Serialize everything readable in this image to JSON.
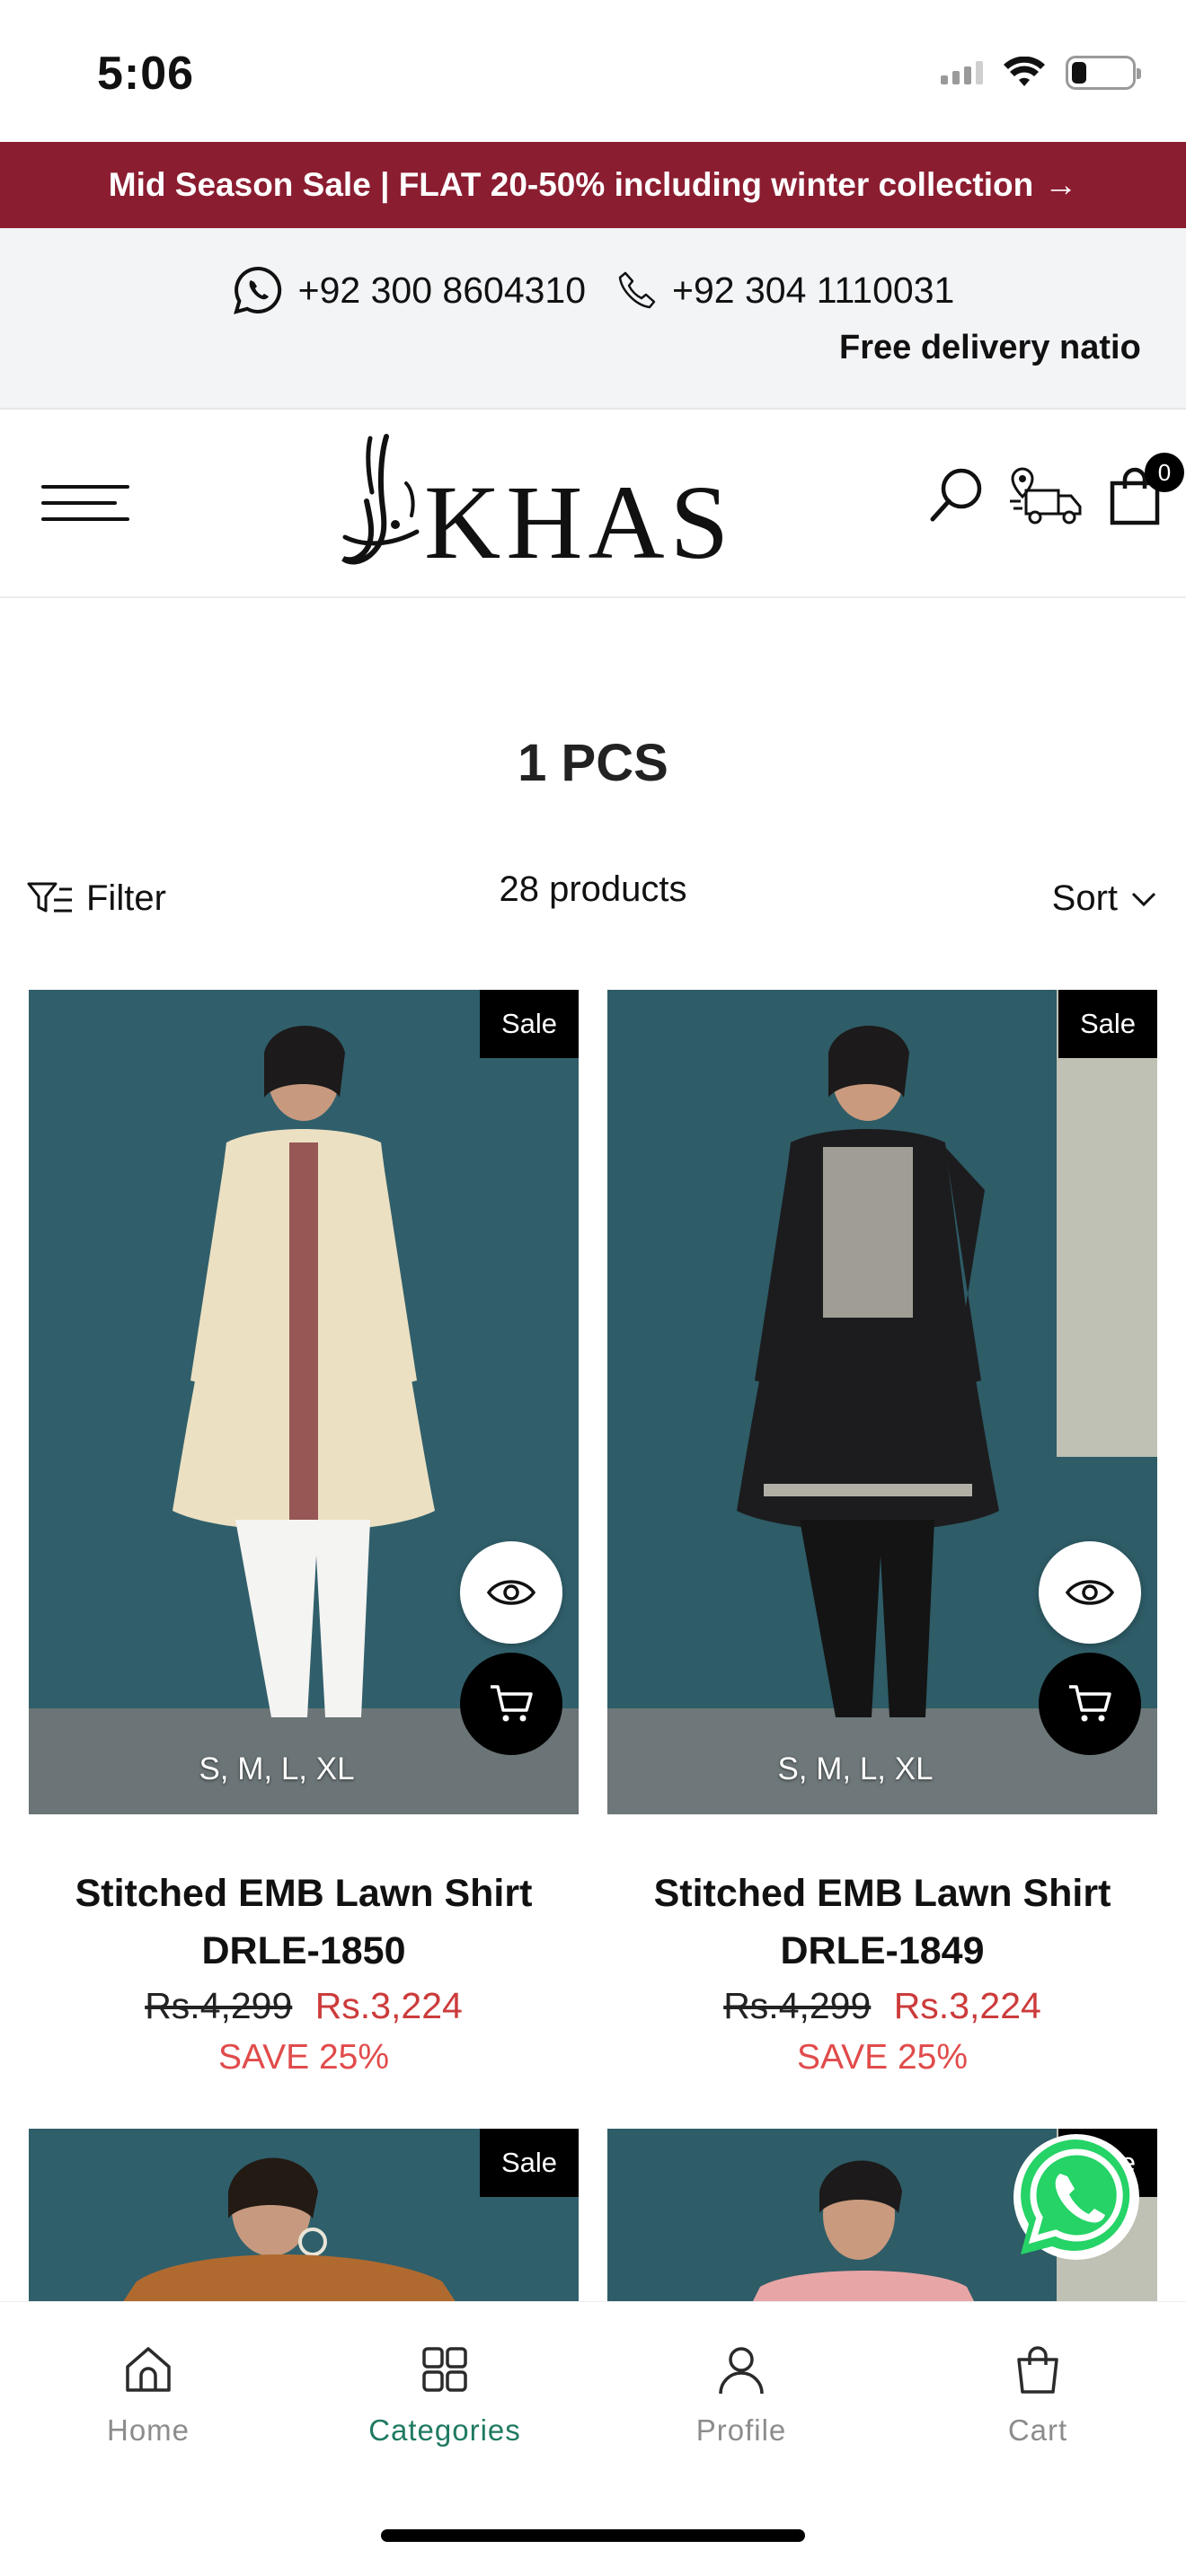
{
  "status_bar": {
    "time": "5:06",
    "battery_level": 0.25
  },
  "promo": {
    "text": "Mid Season Sale | FLAT 20-50% including winter collection",
    "arrow": "→"
  },
  "contact": {
    "whatsapp": "+92 300 8604310",
    "phone": "+92 304 1110031",
    "marquee": "Free delivery natio"
  },
  "header": {
    "logo_text": "KHAS",
    "cart_count": "0"
  },
  "collection": {
    "title": "1 PCS",
    "filter_label": "Filter",
    "count": "28 products",
    "sort_label": "Sort"
  },
  "products": [
    {
      "badge": "Sale",
      "sizes": "S, M, L, XL",
      "name": "Stitched EMB Lawn Shirt DRLE-1850",
      "old_price": "Rs.4,299",
      "new_price": "Rs.3,224",
      "save": "SAVE 25%",
      "dress_color": "#ece0c2",
      "accent_color": "#7a2a30"
    },
    {
      "badge": "Sale",
      "sizes": "S, M, L, XL",
      "name": "Stitched EMB Lawn Shirt DRLE-1849",
      "old_price": "Rs.4,299",
      "new_price": "Rs.3,224",
      "save": "SAVE 25%",
      "dress_color": "#1c1c1e",
      "accent_color": "#d8d4c8"
    },
    {
      "badge": "Sale",
      "dress_color": "#b06a2f"
    },
    {
      "badge": "Sale",
      "dress_color": "#e8a5a5"
    }
  ],
  "bottom_nav": [
    {
      "label": "Home",
      "icon": "home-icon"
    },
    {
      "label": "Categories",
      "icon": "categories-icon",
      "active": true
    },
    {
      "label": "Profile",
      "icon": "profile-icon"
    },
    {
      "label": "Cart",
      "icon": "cart-icon"
    }
  ],
  "colors": {
    "promo_bg": "#8b1d31",
    "sale_price": "#cc3b3b",
    "active_nav": "#1f7a62",
    "whatsapp": "#25d366"
  }
}
